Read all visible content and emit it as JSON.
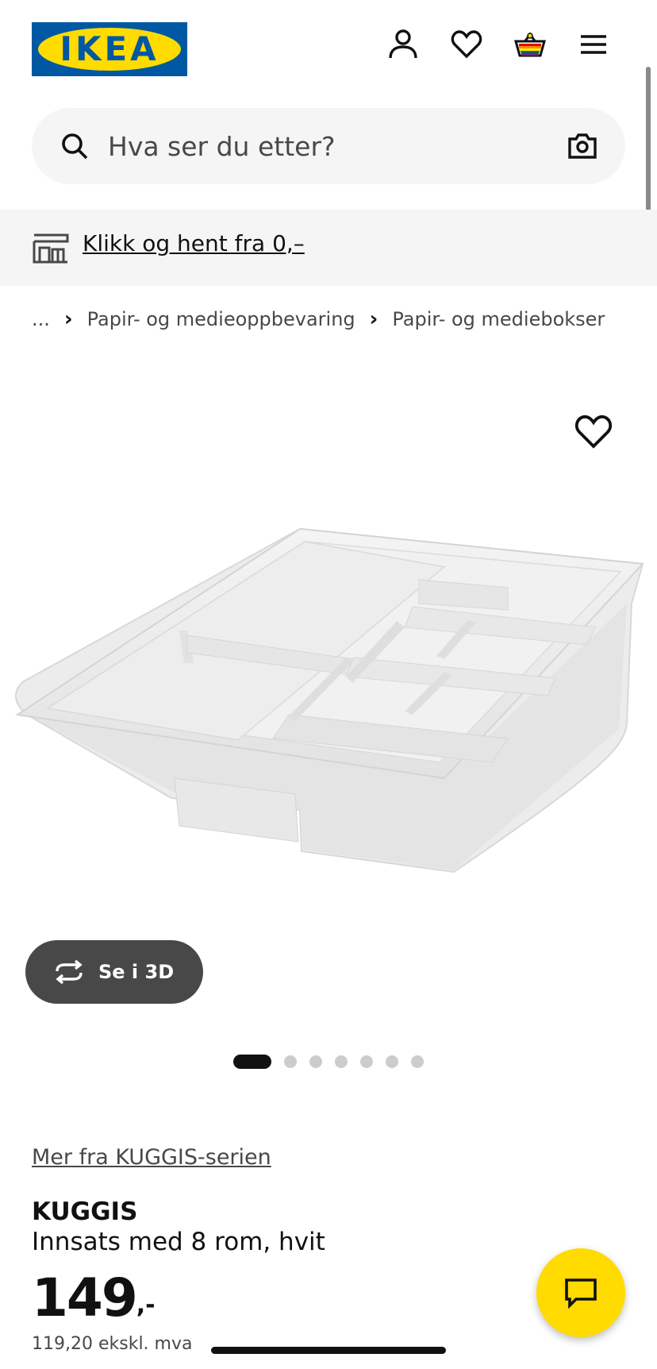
{
  "header": {
    "logo_text": "IKEA",
    "logo_colors": {
      "background": "#0058a3",
      "oval": "#ffdb00"
    },
    "icons": [
      "user-icon",
      "heart-icon",
      "shopping-bag-icon",
      "hamburger-menu-icon"
    ]
  },
  "search": {
    "placeholder": "Hva ser du etter?",
    "value": ""
  },
  "promo": {
    "link_text": "Klikk og hent fra 0,–"
  },
  "breadcrumb": {
    "items": [
      "...",
      "Papir- og medieoppbevaring",
      "Papir- og mediebokser"
    ]
  },
  "gallery": {
    "button_3d_label": "Se i 3D",
    "slide_count": 7,
    "active_slide": 1
  },
  "product": {
    "series_link": "Mer fra KUGGIS-serien",
    "name": "KUGGIS",
    "description": "Innsats med 8 rom, hvit",
    "price_main": "149",
    "price_suffix": ",-",
    "price_ex_vat": "119,20 ekskl. mva"
  },
  "colors": {
    "brand_blue": "#0058a3",
    "brand_yellow": "#ffdb00",
    "text_dark": "#111111",
    "text_muted": "#484848",
    "surface": "#f5f5f5"
  }
}
